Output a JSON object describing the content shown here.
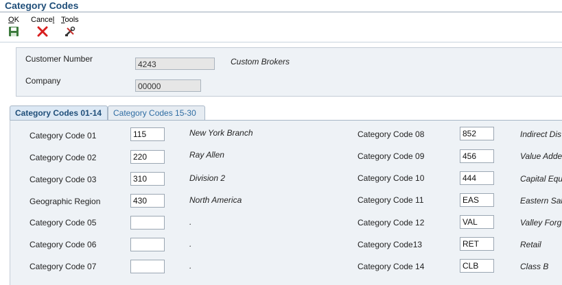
{
  "window": {
    "title": "Category Codes"
  },
  "toolbar": {
    "ok": {
      "label_u": "O",
      "label_rest": "K"
    },
    "cancel": {
      "label_pre": "Cance",
      "label_u": "l"
    },
    "tools": {
      "label_u": "T",
      "label_rest": "ools"
    }
  },
  "header": {
    "customer_number_label": "Customer Number",
    "customer_number_value": "4243",
    "customer_name": "Custom Brokers",
    "company_label": "Company",
    "company_value": "00000"
  },
  "tabs": [
    {
      "label": "Category Codes 01-14",
      "active": true
    },
    {
      "label": "Category Codes 15-30",
      "active": false
    }
  ],
  "left_codes": [
    {
      "label": "Category Code 01",
      "value": "115",
      "desc": "New York Branch"
    },
    {
      "label": "Category Code 02",
      "value": "220",
      "desc": "Ray Allen"
    },
    {
      "label": "Category Code 03",
      "value": "310",
      "desc": "Division 2"
    },
    {
      "label": "Geographic Region",
      "value": "430",
      "desc": "North America"
    },
    {
      "label": "Category Code 05",
      "value": "",
      "desc": "."
    },
    {
      "label": "Category Code 06",
      "value": "",
      "desc": "."
    },
    {
      "label": "Category Code 07",
      "value": "",
      "desc": "."
    }
  ],
  "right_codes": [
    {
      "label": "Category Code 08",
      "value": "852",
      "desc": "Indirect Dis"
    },
    {
      "label": "Category Code 09",
      "value": "456",
      "desc": "Value Adde"
    },
    {
      "label": "Category Code 10",
      "value": "444",
      "desc": "Capital Equ"
    },
    {
      "label": "Category Code 11",
      "value": "EAS",
      "desc": "Eastern Sal"
    },
    {
      "label": "Category Code 12",
      "value": "VAL",
      "desc": "Valley Forg"
    },
    {
      "label": "Category Code13",
      "value": "RET",
      "desc": "Retail"
    },
    {
      "label": "Category Code 14",
      "value": "CLB",
      "desc": "Class B"
    }
  ],
  "icons": {
    "ok": "save-disk-icon",
    "cancel": "red-x-icon",
    "tools": "tools-icon"
  }
}
